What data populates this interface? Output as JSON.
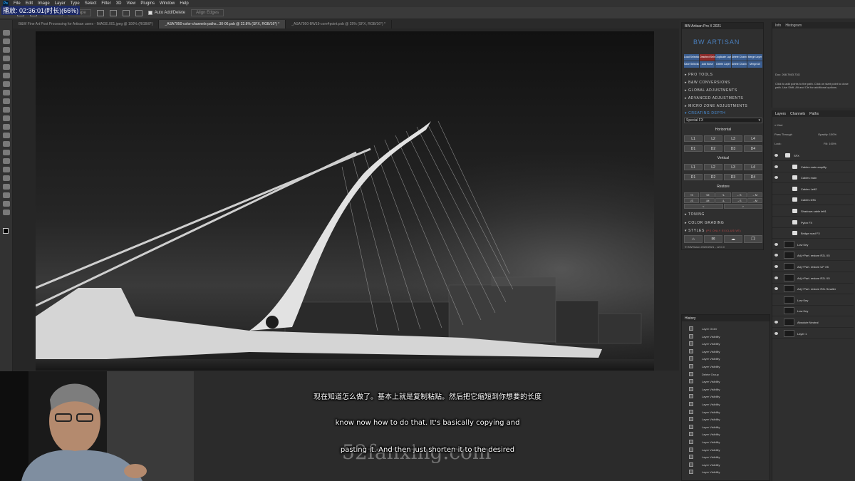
{
  "timestamp": "02:36:01",
  "timestamp_prefix": "播放:",
  "timestamp_suffix": "(时长)(66%)",
  "menu": [
    "File",
    "Edit",
    "Image",
    "Layer",
    "Type",
    "Select",
    "Filter",
    "3D",
    "View",
    "Plugins",
    "Window",
    "Help"
  ],
  "options": {
    "mask_label": "Mask",
    "shape_label": "Shape",
    "auto_add_delete": "Auto Add/Delete",
    "align_edges": "Align Edges"
  },
  "tabs": [
    {
      "label": "B&W Fine Art Post Processing for Artisan users - IMAGE.001.jpeg @ 100% (RGB/8*)",
      "active": false
    },
    {
      "label": "_ASA7950-color-channels-paths...30-06.psb @ 22.8% (SFX, RGB/16*) *",
      "active": true
    },
    {
      "label": "_ASA7950-BW19-core4point.psb @ 25% (SFX, RGB/16*) *",
      "active": false
    }
  ],
  "artisan": {
    "title": "BW Artisan Pro X 2021",
    "logo": "BW ARTISAN",
    "layer_buttons": [
      {
        "label": "Load Selection",
        "red": false
      },
      {
        "label": "Deselect Selection",
        "red": true
      },
      {
        "label": "Duplicate Layer",
        "red": false
      },
      {
        "label": "Delete Channel",
        "red": false
      },
      {
        "label": "Merge Layer",
        "red": false
      },
      {
        "label": "Save Selection",
        "red": false
      },
      {
        "label": "Add Noise",
        "red": false
      },
      {
        "label": "Delete Layer",
        "red": false
      },
      {
        "label": "Delete Channels",
        "red": false
      },
      {
        "label": "Merge All",
        "red": false
      }
    ],
    "sections": [
      "PRO TOOLS",
      "B&W CONVERSIONS",
      "GLOBAL ADJUSTMENTS",
      "ADVANCED ADJUSTMENTS",
      "MICRO ZONE ADJUSTMENTS"
    ],
    "active_section": "CREATING DEPTH",
    "preset": "Special FX",
    "horizontal_label": "Horizontal",
    "horizontal_l": [
      "L1",
      "L2",
      "L3",
      "L4"
    ],
    "horizontal_d": [
      "D1",
      "D2",
      "D3",
      "D4"
    ],
    "vertical_label": "Vertical",
    "vertical_l": [
      "L1",
      "L2",
      "L3",
      "L4"
    ],
    "vertical_d": [
      "D1",
      "D2",
      "D3",
      "D4"
    ],
    "restore_label": "Restore",
    "restore_row1": [
      "↑S",
      "↑M",
      "↑L",
      "←S",
      "←M"
    ],
    "restore_row2": [
      "↓S",
      "↓M",
      "↓L",
      "→S",
      "→M"
    ],
    "restore_row3": [
      "<",
      ">"
    ],
    "bottom_sections": [
      "TONING",
      "COLOR GRADING",
      "STYLES"
    ],
    "styles_badge": "(PS ONLY EXCLUSIVE)",
    "footer": "© BWVision 2020/2021 - v2.0.0"
  },
  "info": {
    "tabs": [
      "Info",
      "Histogram"
    ],
    "doc": "Doc: 268.7M/3.73G",
    "help": "Click to add points to the path. Click on start point to close path. Use Shift, Alt and Ctrl for additional options."
  },
  "layers": {
    "tabs": [
      "Layers",
      "Channels",
      "Paths"
    ],
    "kind": "Kind",
    "blend": "Pass Through",
    "opacity_label": "Opacity:",
    "opacity": "100%",
    "lock_label": "Lock:",
    "fill_label": "Fill:",
    "fill": "100%",
    "rows": [
      {
        "name": "SFX",
        "type": "group-open",
        "visible": true
      },
      {
        "name": "Cables main amplify",
        "type": "group",
        "visible": true
      },
      {
        "name": "Cables main",
        "type": "group",
        "visible": true
      },
      {
        "name": "Cables Left2",
        "type": "group",
        "visible": false
      },
      {
        "name": "Cables left1",
        "type": "group",
        "visible": false
      },
      {
        "name": "Shadows cable left1",
        "type": "group",
        "visible": false
      },
      {
        "name": "Pylon FX",
        "type": "group",
        "visible": false
      },
      {
        "name": "Bridge road FX",
        "type": "group",
        "visible": false
      },
      {
        "name": "Low Key",
        "type": "layer",
        "visible": true
      },
      {
        "name": "Adj.+Part. restore R2L X5",
        "type": "layer",
        "visible": true
      },
      {
        "name": "Adj.+Part. restore UP X5",
        "type": "layer",
        "visible": true
      },
      {
        "name": "Adj.+Part. restore R2L X5",
        "type": "layer",
        "visible": true
      },
      {
        "name": "Adj.+Part. restore R2L Smaller",
        "type": "layer",
        "visible": true
      },
      {
        "name": "Low Key",
        "type": "layer",
        "visible": false
      },
      {
        "name": "Low Key",
        "type": "layer",
        "visible": false
      },
      {
        "name": "Absolute Neutral",
        "type": "layer",
        "visible": true
      },
      {
        "name": "Layer 1",
        "type": "layer",
        "visible": true
      }
    ]
  },
  "history": {
    "title": "History",
    "items": [
      "Layer Order",
      "Layer Visibility",
      "Layer Visibility",
      "Layer Visibility",
      "Layer Visibility",
      "Layer Visibility",
      "Delete Group",
      "Layer Visibility",
      "Layer Visibility",
      "Layer Visibility",
      "Layer Visibility",
      "Layer Visibility",
      "Layer Visibility",
      "Layer Visibility",
      "Layer Visibility",
      "Layer Visibility",
      "Layer Visibility",
      "Layer Visibility",
      "Layer Visibility",
      "Layer Visibility"
    ]
  },
  "subtitles": {
    "chinese": "现在知道怎么做了。基本上就是复制粘贴。然后把它缩短到你想要的长度",
    "english_line1": "know now how to do that. It's basically copying and",
    "english_line2": "pasting it. And then just shorten it to the desired"
  },
  "watermark": "52fanxing.com"
}
